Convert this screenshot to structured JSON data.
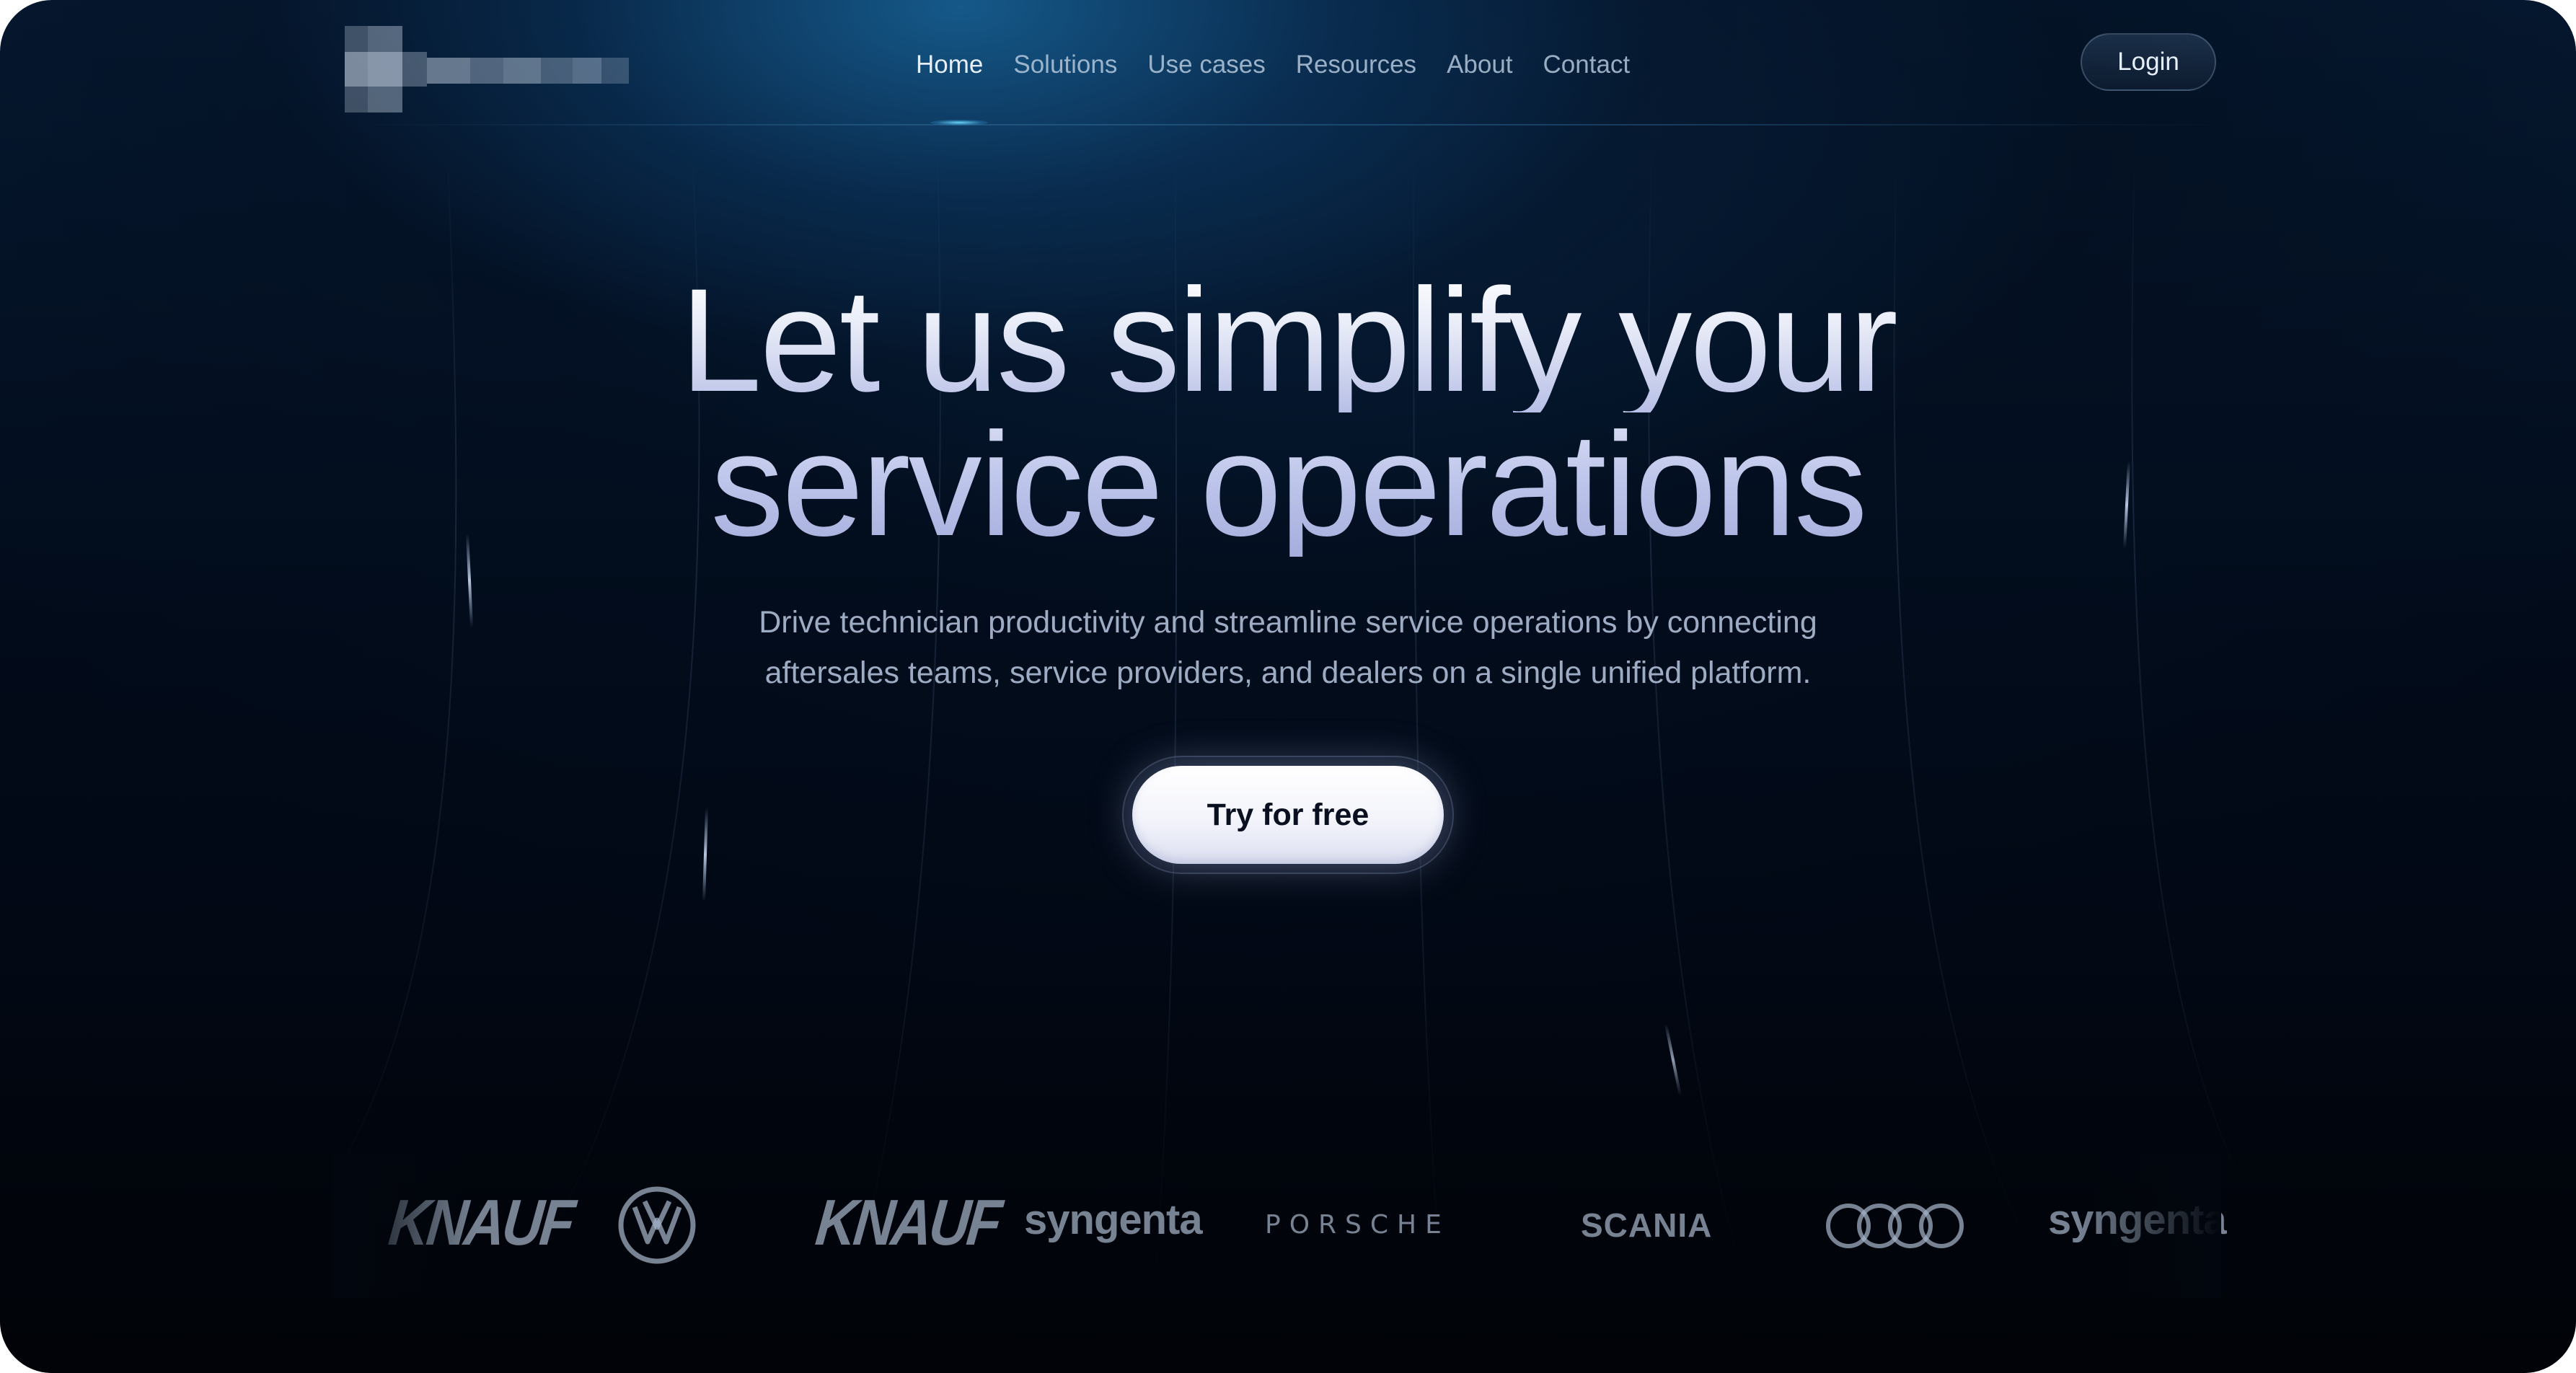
{
  "nav": {
    "logo_icon": "logo-pixelated",
    "links": [
      {
        "label": "Home",
        "active": true
      },
      {
        "label": "Solutions",
        "active": false
      },
      {
        "label": "Use cases",
        "active": false
      },
      {
        "label": "Resources",
        "active": false
      },
      {
        "label": "About",
        "active": false
      },
      {
        "label": "Contact",
        "active": false
      }
    ],
    "login_label": "Login"
  },
  "hero": {
    "title_line1": "Let us simplify your",
    "title_line2": "service operations",
    "subtitle_line1": "Drive technician productivity and streamline service operations by connecting",
    "subtitle_line2": "aftersales teams, service providers, and dealers on a single unified platform.",
    "cta_label": "Try for free"
  },
  "brands": [
    {
      "name": "KNAUF",
      "icon": "knauf-logo"
    },
    {
      "name": "Volkswagen",
      "icon": "volkswagen-logo"
    },
    {
      "name": "KNAUF",
      "icon": "knauf-logo"
    },
    {
      "name": "syngenta",
      "icon": "syngenta-logo"
    },
    {
      "name": "PORSCHE",
      "icon": "porsche-logo"
    },
    {
      "name": "SCANIA",
      "icon": "scania-logo"
    },
    {
      "name": "Audi",
      "icon": "audi-logo"
    },
    {
      "name": "syngenta",
      "icon": "syngenta-logo"
    }
  ],
  "colors": {
    "background_top": "#061a33",
    "background_bottom": "#01040c",
    "accent_glow": "#165c8e",
    "cta_background": "#ffffff",
    "cta_text": "#0b1020",
    "nav_text": "#b9cde1",
    "nav_active_text": "#e6eef8"
  }
}
